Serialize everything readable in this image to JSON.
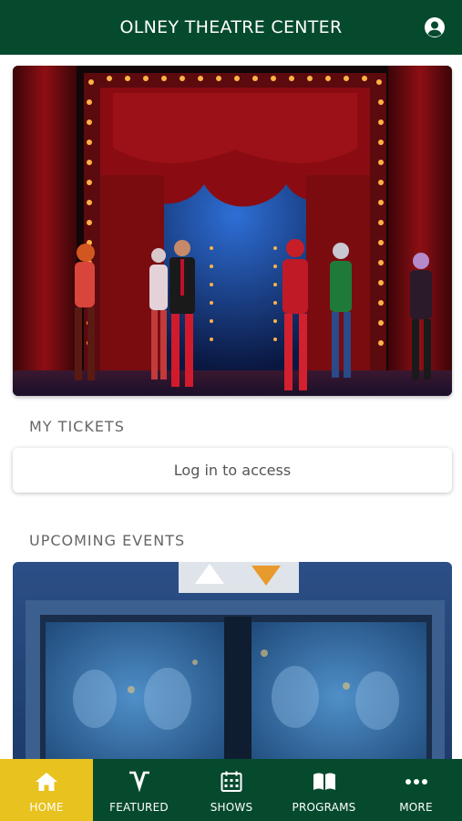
{
  "header": {
    "title": "OLNEY THEATRE CENTER",
    "account_icon": "account-circle-icon"
  },
  "hero": {
    "image": "stage-performance-photo"
  },
  "my_tickets": {
    "heading": "MY TICKETS",
    "login_label": "Log in to access"
  },
  "upcoming": {
    "heading": "UPCOMING EVENTS",
    "image": "event-poster-photo"
  },
  "nav": {
    "items": [
      {
        "label": "HOME",
        "icon": "home-icon",
        "active": true
      },
      {
        "label": "FEATURED",
        "icon": "featured-v-icon",
        "active": false
      },
      {
        "label": "SHOWS",
        "icon": "calendar-icon",
        "active": false
      },
      {
        "label": "PROGRAMS",
        "icon": "book-icon",
        "active": false
      },
      {
        "label": "MORE",
        "icon": "more-dots-icon",
        "active": false
      }
    ]
  },
  "colors": {
    "brand_green": "#064a2e",
    "active_yellow": "#e8c21f"
  }
}
